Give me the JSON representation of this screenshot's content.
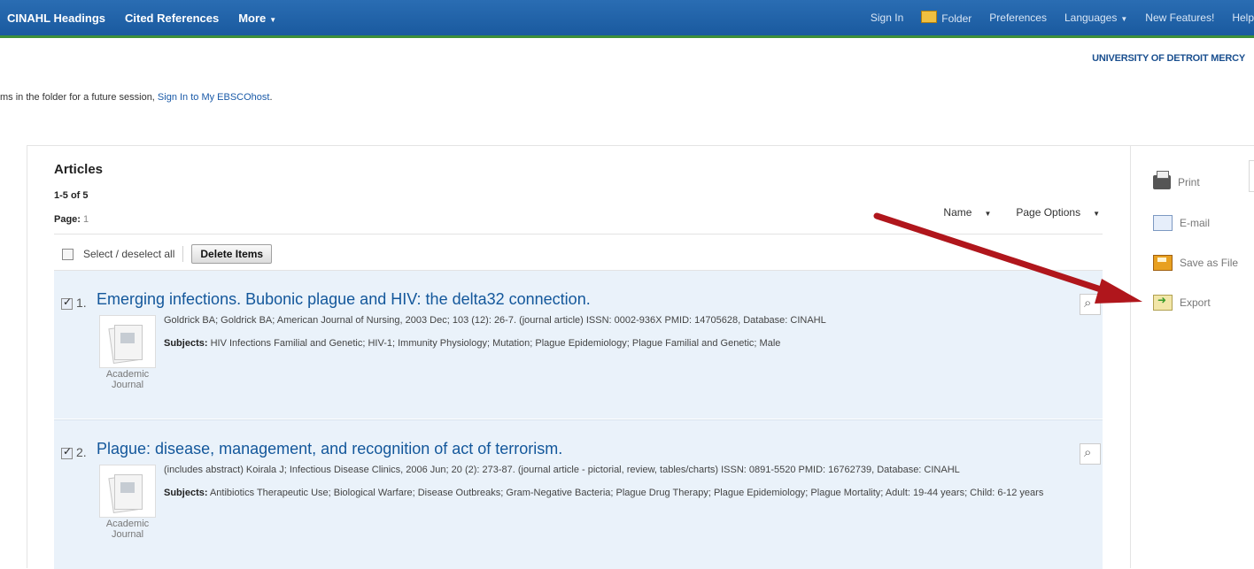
{
  "topnav": {
    "left": [
      "CINAHL Headings",
      "Cited References",
      "More"
    ],
    "right": [
      "Sign In",
      "Folder",
      "Preferences",
      "Languages",
      "New Features!",
      "Help"
    ]
  },
  "institution": "UNIVERSITY OF DETROIT MERCY",
  "notice": {
    "text": "ms in the folder for a future session, ",
    "link": "Sign In to My EBSCOhost",
    "end": "."
  },
  "section": {
    "title": "Articles",
    "range": "1-5 of 5",
    "page_label": "Page:",
    "page_number": "1"
  },
  "options": {
    "name": "Name",
    "page_options": "Page Options"
  },
  "select_all_label": "Select / deselect all",
  "delete_label": "Delete Items",
  "results": [
    {
      "number": "1.",
      "title": "Emerging infections. Bubonic plague and HIV: the delta32 connection.",
      "meta": "Goldrick BA; Goldrick BA; American Journal of Nursing, 2003 Dec; 103 (12): 26-7. (journal article) ISSN: 0002-936X PMID: 14705628, Database: CINAHL",
      "subjects_label": "Subjects:",
      "subjects": "HIV Infections Familial and Genetic; HIV-1; Immunity Physiology; Mutation; Plague Epidemiology; Plague Familial and Genetic; Male",
      "type_line1": "Academic",
      "type_line2": "Journal"
    },
    {
      "number": "2.",
      "title": "Plague: disease, management, and recognition of act of terrorism.",
      "meta": "(includes abstract) Koirala J; Infectious Disease Clinics, 2006 Jun; 20 (2): 273-87. (journal article - pictorial, review, tables/charts) ISSN: 0891-5520 PMID: 16762739, Database: CINAHL",
      "subjects_label": "Subjects:",
      "subjects": "Antibiotics Therapeutic Use; Biological Warfare; Disease Outbreaks; Gram-Negative Bacteria; Plague Drug Therapy; Plague Epidemiology; Plague Mortality; Adult: 19-44 years; Child: 6-12 years",
      "type_line1": "Academic",
      "type_line2": "Journal"
    }
  ],
  "tools": [
    "Print",
    "E-mail",
    "Save as File",
    "Export"
  ],
  "colors": {
    "nav": "#1f63a8",
    "accent": "#3d8f3a",
    "result_bg": "#eaf2fa",
    "link": "#13579b",
    "arrow": "#b0161c"
  }
}
